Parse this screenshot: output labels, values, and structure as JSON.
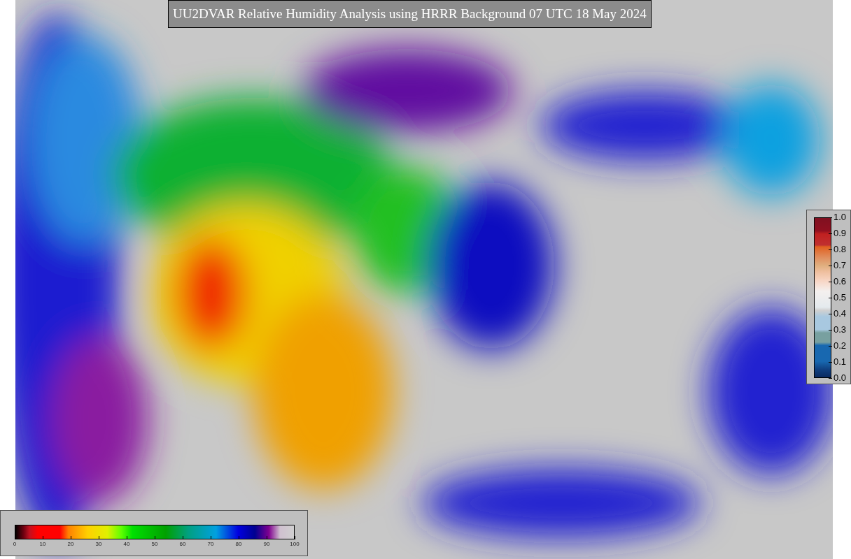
{
  "title": "UU2DVAR Relative Humidity Analysis using HRRR Background 07 UTC 18 May 2024",
  "humidity_colorbar": {
    "ticks": [
      "0",
      "10",
      "20",
      "30",
      "40",
      "50",
      "60",
      "70",
      "80",
      "90",
      "100"
    ]
  },
  "observation_colorbar": {
    "ticks": [
      "1.0",
      "0.9",
      "0.8",
      "0.7",
      "0.6",
      "0.5",
      "0.4",
      "0.3",
      "0.2",
      "0.1",
      "0.0"
    ]
  }
}
